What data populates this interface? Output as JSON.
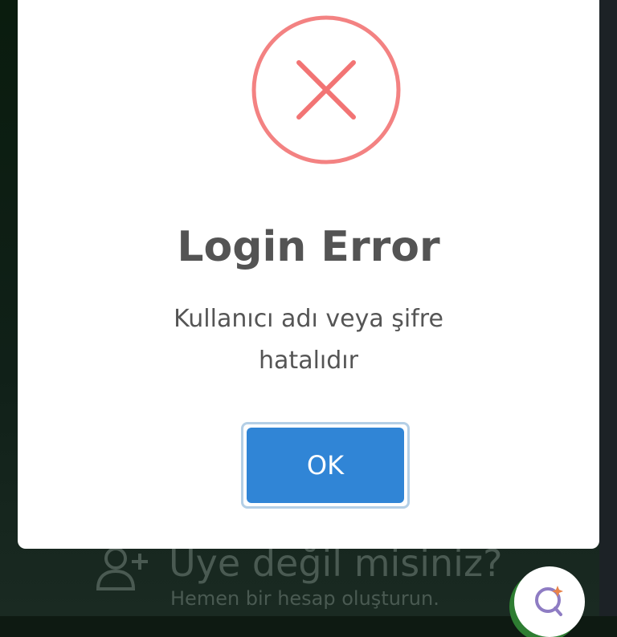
{
  "dialog": {
    "title": "Login Error",
    "message": "Kullanıcı adı veya şifre hatalıdır",
    "ok_label": "OK",
    "icon": "error-x-icon",
    "icon_color": "#f27474",
    "button_color": "#3085d6"
  },
  "background": {
    "signup_title": "Üye değil misiniz?",
    "signup_subtitle": "Hemen bir hesap oluşturun.",
    "signup_icon": "add-user-icon",
    "fab_icon": "assistant-icon"
  }
}
